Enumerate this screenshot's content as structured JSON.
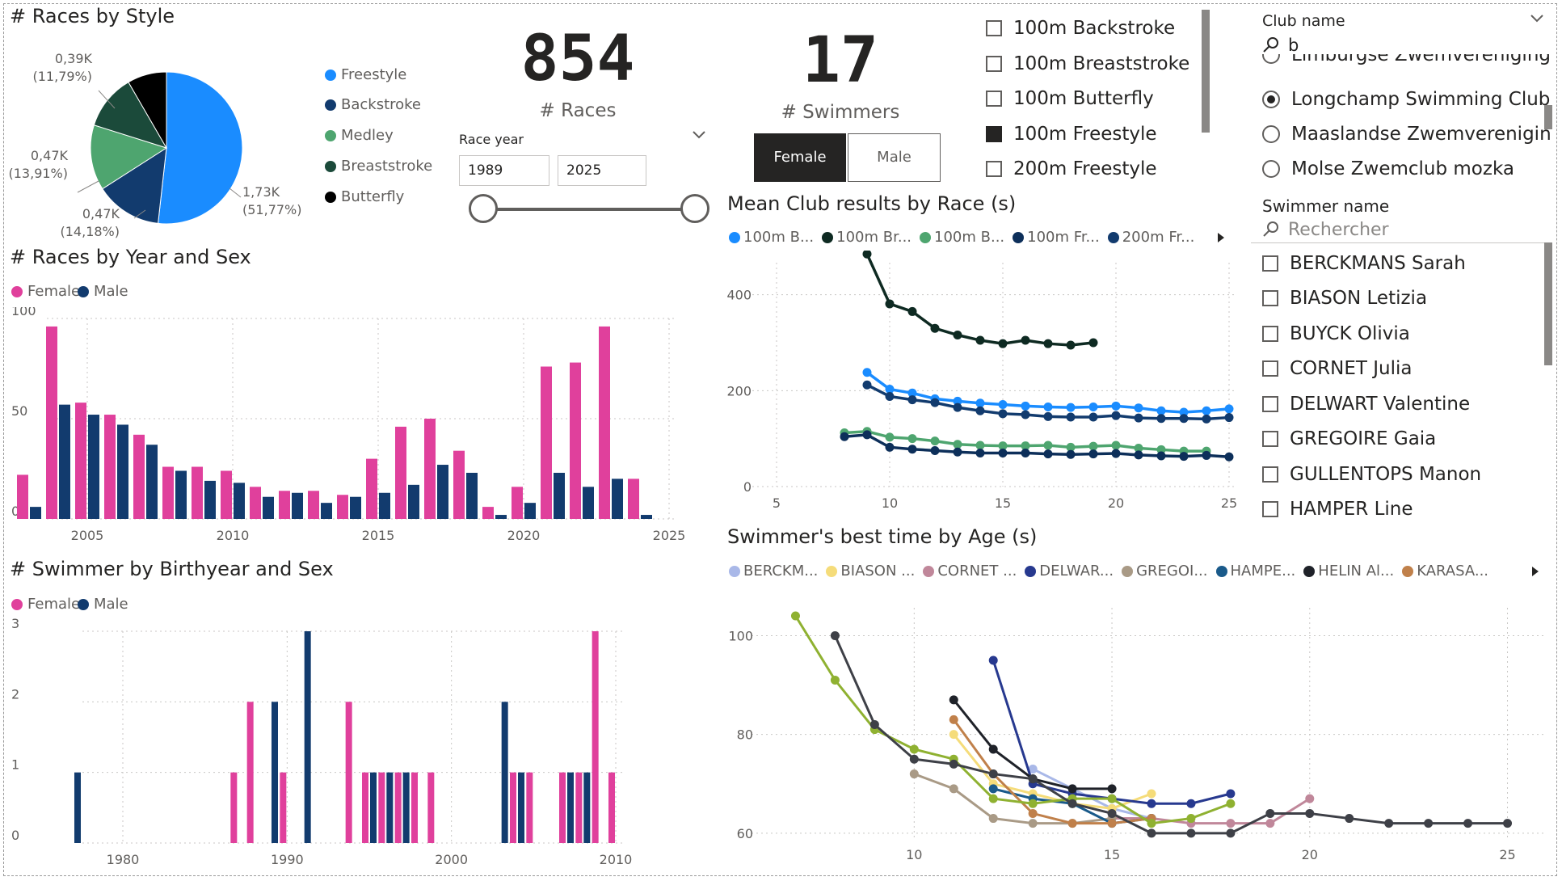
{
  "colors": {
    "female": "#e0409c",
    "male": "#123b6e",
    "freestyle": "#1a8cff",
    "backstroke": "#123b6e",
    "medley": "#4ea56f",
    "breaststroke": "#1b4a3a",
    "butterfly": "#000000",
    "grid": "#c8c6c4"
  },
  "pie": {
    "title": "# Races by Style",
    "legend": [
      "Freestyle",
      "Backstroke",
      "Medley",
      "Breaststroke",
      "Butterfly"
    ],
    "labels": [
      {
        "value": "1,73K",
        "pct": "(51,77%)"
      },
      {
        "value": "0,47K",
        "pct": "(14,18%)"
      },
      {
        "value": "0,47K",
        "pct": "(13,91%)"
      },
      {
        "value": "0,39K",
        "pct": "(11,79%)"
      }
    ]
  },
  "cards": {
    "races_value": "854",
    "races_label": "# Races",
    "swimmers_value": "17",
    "swimmers_label": "# Swimmers"
  },
  "race_year": {
    "title": "Race year",
    "from": "1989",
    "to": "2025"
  },
  "sex_buttons": {
    "female": "Female",
    "male": "Male"
  },
  "race_list": [
    "100m Backstroke",
    "100m Breaststroke",
    "100m Butterfly",
    "100m Freestyle",
    "200m Freestyle"
  ],
  "club": {
    "title": "Club name",
    "search": "b",
    "items": [
      "Limburgse Zwemvereniging",
      "Longchamp Swimming Club ...",
      "Maaslandse Zwemverenigin...",
      "Molse Zwemclub mozka"
    ]
  },
  "swimmer": {
    "title": "Swimmer name",
    "search_placeholder": "Rechercher",
    "items": [
      "BERCKMANS Sarah",
      "BIASON Letizia",
      "BUYCK Olivia",
      "CORNET Julia",
      "DELWART Valentine",
      "GREGOIRE Gaia",
      "GULLENTOPS Manon",
      "HAMPER Line"
    ]
  },
  "chart_data": [
    {
      "type": "pie",
      "title": "# Races by Style",
      "categories": [
        "Freestyle",
        "Backstroke",
        "Medley",
        "Breaststroke",
        "Butterfly"
      ],
      "values": [
        51.77,
        14.18,
        13.91,
        11.79,
        8.35
      ]
    },
    {
      "type": "bar",
      "title": "# Races by Year and Sex",
      "x": [
        2003,
        2004,
        2005,
        2006,
        2007,
        2008,
        2009,
        2010,
        2011,
        2012,
        2013,
        2014,
        2015,
        2016,
        2017,
        2018,
        2019,
        2020,
        2021,
        2022,
        2023,
        2024,
        2025
      ],
      "x_ticks": [
        "2005",
        "2010",
        "2015",
        "2020",
        "2025"
      ],
      "y_ticks": [
        "0",
        "50",
        "100"
      ],
      "ylim": [
        0,
        100
      ],
      "series": [
        {
          "name": "Female",
          "values": [
            22,
            96,
            58,
            52,
            42,
            26,
            26,
            24,
            16,
            14,
            14,
            12,
            30,
            46,
            50,
            34,
            6,
            16,
            76,
            78,
            96,
            20,
            0
          ]
        },
        {
          "name": "Male",
          "values": [
            6,
            57,
            52,
            47,
            37,
            24,
            19,
            18,
            11,
            13,
            8,
            11,
            13,
            17,
            27,
            23,
            2,
            8,
            23,
            16,
            20,
            2,
            0
          ]
        }
      ]
    },
    {
      "type": "bar",
      "title": "# Swimmer by Birthyear and Sex",
      "x": [
        1977,
        1987,
        1988,
        1989,
        1990,
        1991,
        1994,
        1995,
        1996,
        1997,
        1998,
        1999,
        2003,
        2004,
        2005,
        2007,
        2008,
        2009,
        2010
      ],
      "x_ticks": [
        "1980",
        "1990",
        "2000",
        "2010"
      ],
      "y_ticks": [
        "0",
        "1",
        "2",
        "3"
      ],
      "ylim": [
        0,
        3
      ],
      "series": [
        {
          "name": "Female",
          "values": [
            0,
            1,
            2,
            0,
            1,
            0,
            2,
            1,
            1,
            1,
            1,
            1,
            0,
            1,
            1,
            1,
            1,
            3,
            1
          ]
        },
        {
          "name": "Male",
          "values": [
            1,
            0,
            0,
            2,
            0,
            3,
            0,
            1,
            1,
            1,
            0,
            0,
            2,
            1,
            0,
            1,
            1,
            0,
            0
          ]
        }
      ]
    },
    {
      "type": "line",
      "title": "Mean Club results by Race (s)",
      "x_ticks": [
        "5",
        "10",
        "15",
        "20",
        "25"
      ],
      "y_ticks": [
        "0",
        "200",
        "400"
      ],
      "xlim": [
        5,
        25
      ],
      "ylim": [
        0,
        450
      ],
      "legend": [
        "100m B...",
        "100m Br...",
        "100m B...",
        "100m Fr...",
        "200m Fr..."
      ],
      "series": [
        {
          "name": "100m B...",
          "color": "#1a8cff",
          "x": [
            9,
            10,
            11,
            12,
            13,
            14,
            15,
            16,
            17,
            18,
            19,
            20,
            21,
            22,
            23,
            24,
            25
          ],
          "y": [
            238,
            203,
            195,
            183,
            178,
            174,
            171,
            168,
            166,
            165,
            166,
            168,
            164,
            158,
            155,
            158,
            162
          ]
        },
        {
          "name": "100m Br...",
          "color": "#0e2a22",
          "x": [
            9,
            10,
            11,
            12,
            13,
            14,
            15,
            16,
            17,
            18,
            19
          ],
          "y": [
            485,
            381,
            365,
            330,
            316,
            305,
            298,
            305,
            298,
            295,
            300
          ]
        },
        {
          "name": "100m B...",
          "color": "#4ea56f",
          "x": [
            8,
            9,
            10,
            11,
            12,
            13,
            14,
            15,
            16,
            17,
            18,
            19,
            20,
            21,
            22,
            23,
            24
          ],
          "y": [
            112,
            115,
            103,
            100,
            95,
            88,
            86,
            85,
            85,
            86,
            82,
            84,
            86,
            80,
            77,
            74,
            74
          ]
        },
        {
          "name": "100m Fr...",
          "color": "#0d2f5a",
          "x": [
            8,
            9,
            10,
            11,
            12,
            13,
            14,
            15,
            16,
            17,
            18,
            19,
            20,
            21,
            22,
            23,
            24,
            25
          ],
          "y": [
            104,
            108,
            82,
            78,
            75,
            72,
            70,
            70,
            70,
            68,
            67,
            68,
            69,
            66,
            64,
            63,
            65,
            62
          ]
        },
        {
          "name": "200m Fr...",
          "color": "#123b6e",
          "x": [
            9,
            10,
            11,
            12,
            13,
            14,
            15,
            16,
            17,
            18,
            19,
            20,
            21,
            22,
            23,
            24,
            25
          ],
          "y": [
            212,
            188,
            181,
            175,
            165,
            158,
            152,
            150,
            146,
            145,
            145,
            148,
            143,
            142,
            142,
            141,
            144
          ]
        }
      ]
    },
    {
      "type": "line",
      "title": "Swimmer's best time by Age (s)",
      "x_ticks": [
        "10",
        "15",
        "20",
        "25"
      ],
      "y_ticks": [
        "60",
        "80",
        "100"
      ],
      "xlim": [
        6.5,
        25.5
      ],
      "ylim": [
        59,
        104
      ],
      "legend": [
        "BERCKM...",
        "BIASON ...",
        "CORNET ...",
        "DELWAR...",
        "GREGOI...",
        "HAMPE...",
        "HELIN Al...",
        "KARASA..."
      ],
      "series": [
        {
          "name": "BERCKM...",
          "color": "#a9b8e8",
          "x": [
            13,
            14,
            15,
            16
          ],
          "y": [
            73,
            69,
            65,
            63
          ]
        },
        {
          "name": "BIASON ...",
          "color": "#f5dc7a",
          "x": [
            11,
            12,
            13,
            14,
            15,
            16
          ],
          "y": [
            80,
            70,
            68,
            66,
            65,
            68
          ]
        },
        {
          "name": "CORNET ...",
          "color": "#c0879a",
          "x": [
            15,
            16,
            17,
            18,
            19,
            20
          ],
          "y": [
            63,
            63,
            62,
            62,
            62,
            67
          ]
        },
        {
          "name": "DELWAR...",
          "color": "#27398f",
          "x": [
            12,
            13,
            14,
            15,
            16,
            17,
            18
          ],
          "y": [
            95,
            70,
            68,
            67,
            66,
            66,
            68
          ]
        },
        {
          "name": "GREGOI...",
          "color": "#a99a86",
          "x": [
            10,
            11,
            12,
            13,
            14,
            15
          ],
          "y": [
            72,
            69,
            63,
            62,
            62,
            63
          ]
        },
        {
          "name": "HAMPE...",
          "color": "#1a5a8a",
          "x": [
            12,
            13,
            14,
            15,
            16
          ],
          "y": [
            69,
            67,
            66,
            62,
            63
          ]
        },
        {
          "name": "HELIN Al...",
          "color": "#1f2229",
          "x": [
            11,
            12,
            13,
            14,
            15
          ],
          "y": [
            87,
            77,
            71,
            69,
            69
          ]
        },
        {
          "name": "KARASA...",
          "color": "#c0804a",
          "x": [
            11,
            12,
            13,
            14,
            15,
            16
          ],
          "y": [
            83,
            72,
            64,
            62,
            62,
            63
          ]
        },
        {
          "name": "",
          "color": "#8fb131",
          "x": [
            7,
            8,
            9,
            10,
            11,
            12,
            13,
            14,
            15,
            16,
            17,
            18
          ],
          "y": [
            104,
            91,
            81,
            77,
            75,
            67,
            66,
            67,
            67,
            62,
            63,
            66
          ]
        },
        {
          "name": "",
          "color": "#3e4047",
          "x": [
            8,
            9,
            10,
            11,
            12,
            13,
            14,
            15,
            16,
            17,
            18,
            19,
            20,
            21,
            22,
            23,
            24,
            25
          ],
          "y": [
            100,
            82,
            75,
            74,
            72,
            71,
            66,
            64,
            60,
            60,
            60,
            64,
            64,
            63,
            62,
            62,
            62,
            62
          ]
        }
      ]
    }
  ]
}
